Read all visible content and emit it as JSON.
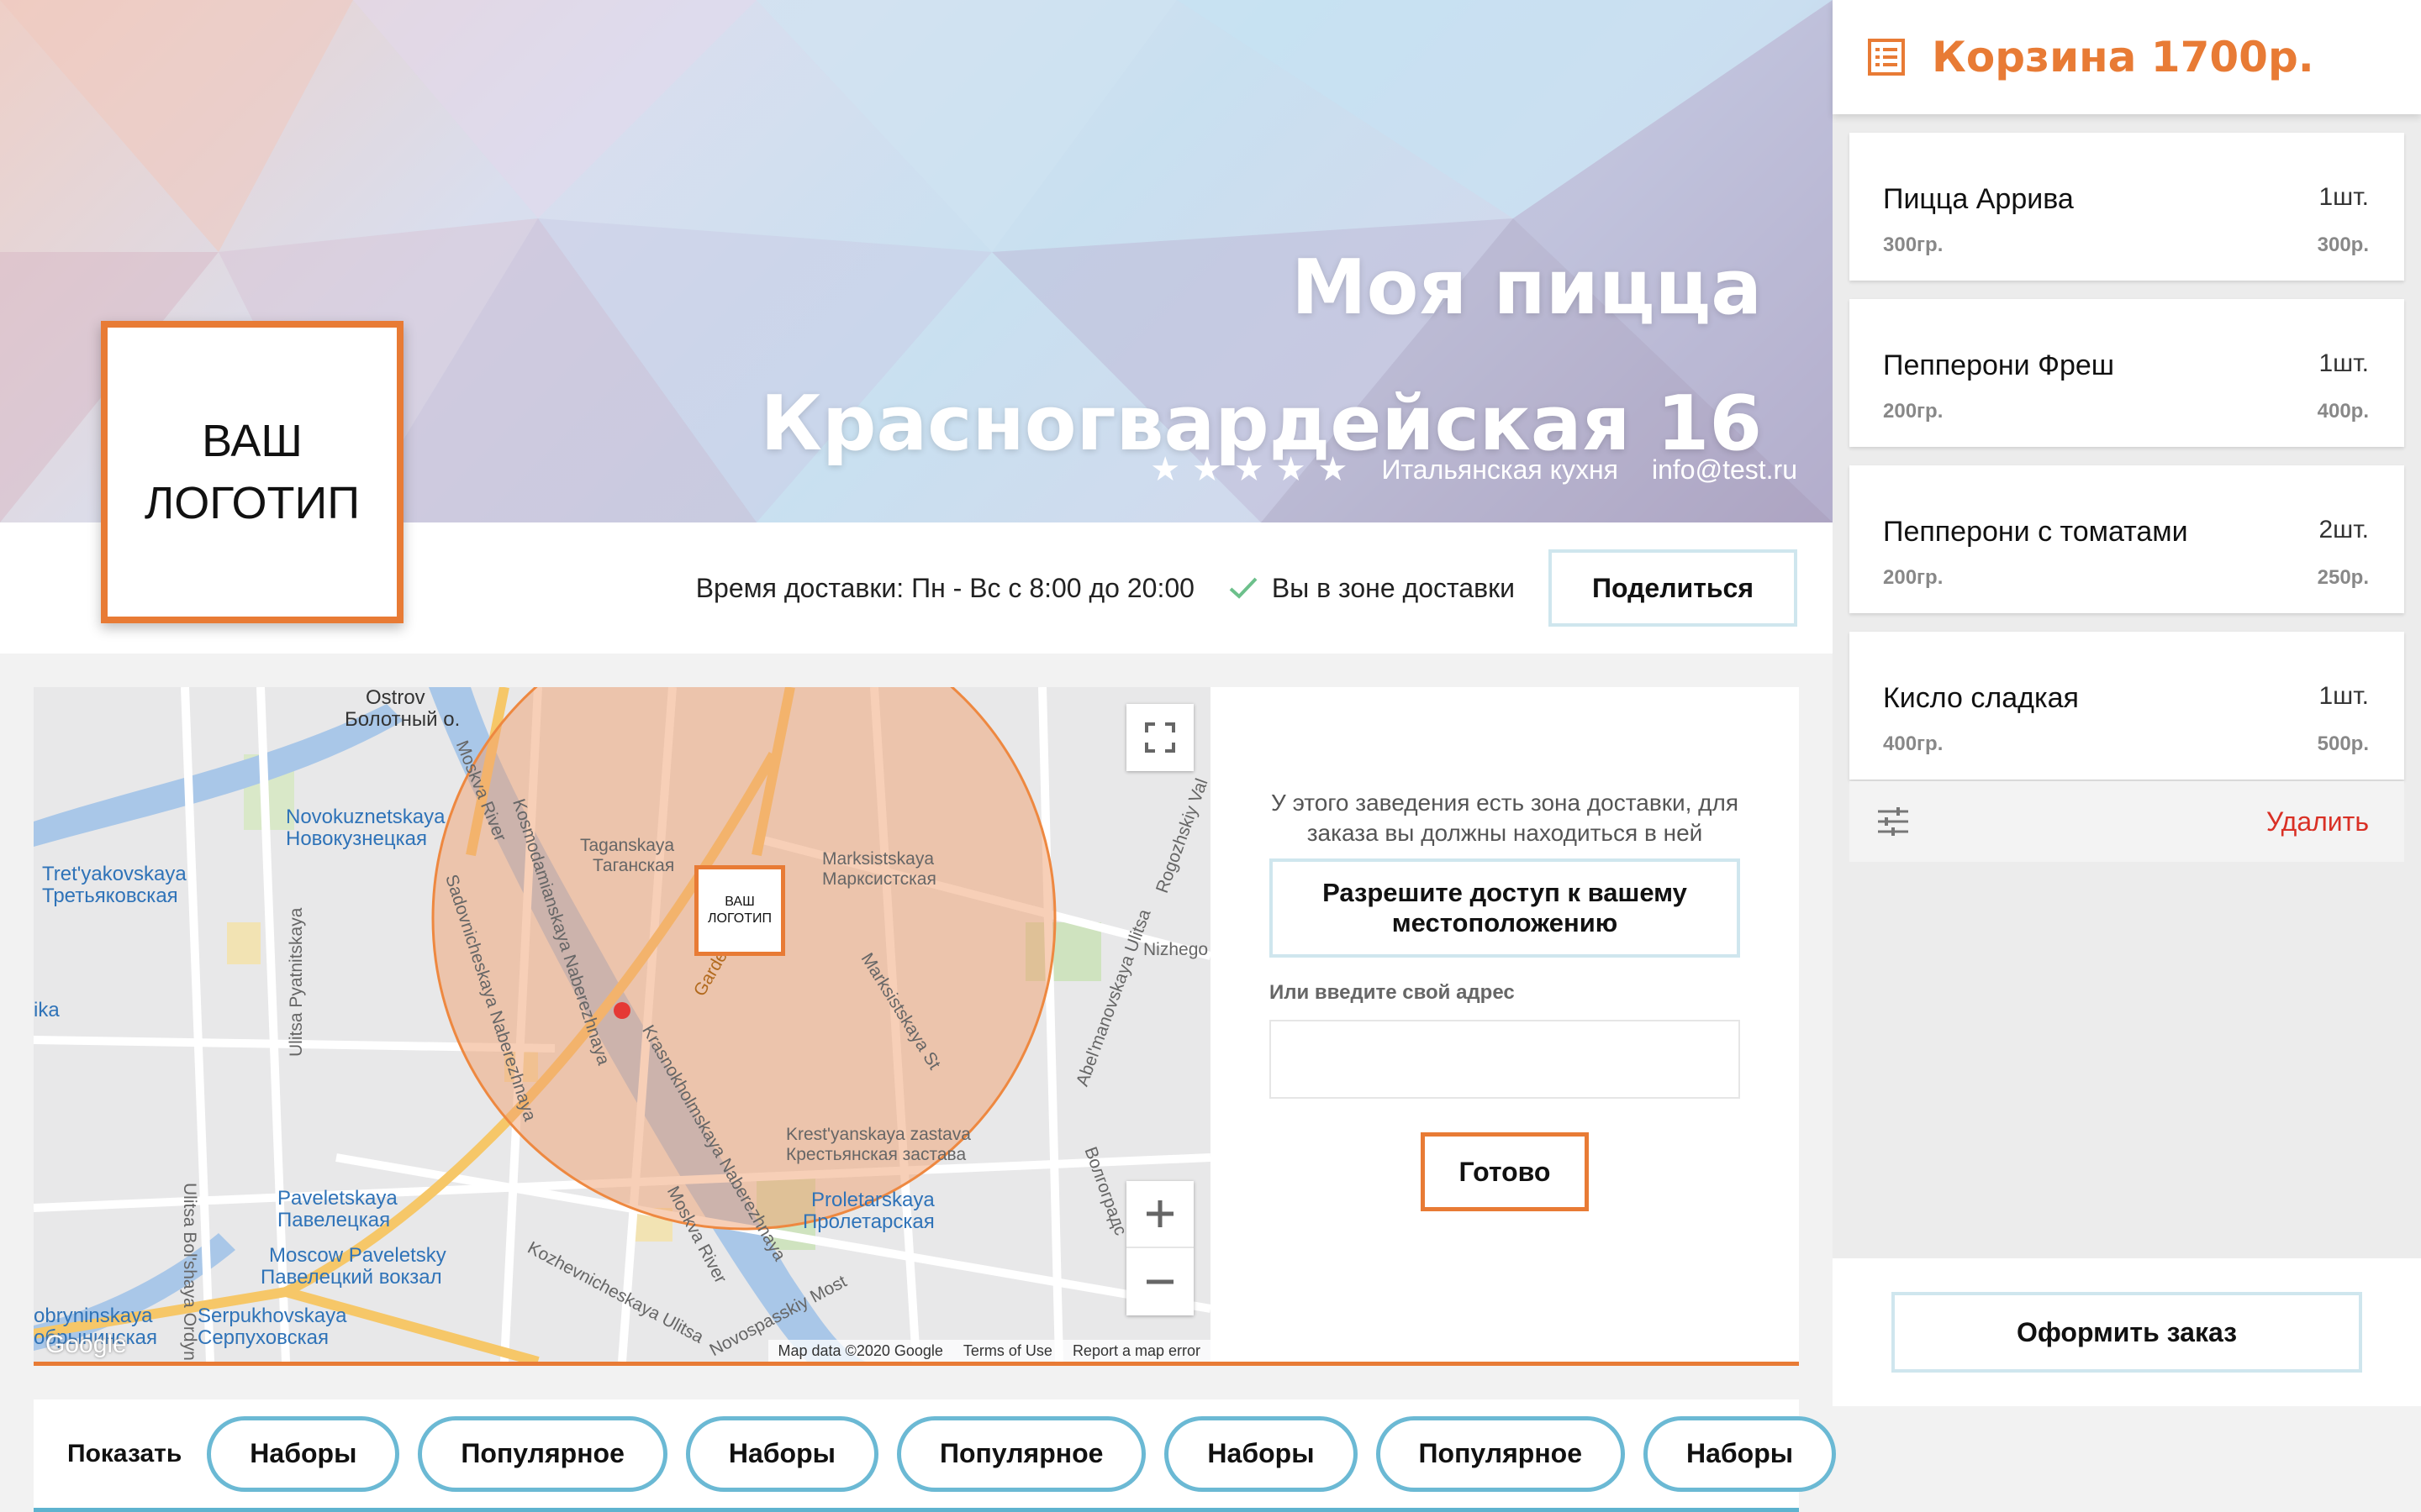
{
  "restaurant": {
    "name_line1": "Моя пицца",
    "name_line2": "Красногвардейская 16",
    "rating_stars": 5,
    "cuisine": "Итальянская кухня",
    "email": "info@test.ru",
    "logo_text_line1": "ВАШ",
    "logo_text_line2": "ЛОГОТИП"
  },
  "info_bar": {
    "delivery_time": "Время доставки: Пн - Вс с 8:00 до 20:00",
    "zone_status": "Вы в зоне доставки",
    "share_label": "Поделиться"
  },
  "map": {
    "labels": {
      "ostrov": "Ostrov",
      "ostrov_ru": "Болотный о.",
      "novokuznetskaya": "Novokuznetskaya",
      "novokuznetskaya_ru": "Новокузнецкая",
      "tretyakovskaya": "Tret'yakovskaya",
      "tretyakovskaya_ru": "Третьяковская",
      "taganskaya": "Taganskaya",
      "taganskaya_ru": "Таганская",
      "marksistskaya": "Marksistskaya",
      "marksistskaya_ru": "Марксистская",
      "paveletskaya": "Paveletskaya",
      "paveletskaya_ru": "Павелецкая",
      "moscow_paveletsky": "Moscow Paveletsky",
      "paveletsky_ru": "Павелецкий вокзал",
      "krestyanskaya": "Krest'yanskaya zastava",
      "krestyanskaya_ru": "Крестьянская застава",
      "proletarskaya": "Proletarskaya",
      "proletarskaya_ru": "Пролетарская",
      "serpukhovskaya": "Serpukhovskaya",
      "serpukhovskaya_ru": "Серпуховская",
      "dobryninskaya": "obryninskaya",
      "dobryninskaya_ru": "обрынинская",
      "nizhego": "Nizhego",
      "ika": "ika",
      "moskva_river": "Moskva River",
      "moskva_river2": "Moskva River",
      "garden": "Garden",
      "kosmodamianskaya": "Kosmodamianskaya Naberezhnaya",
      "sadovnicheskaya": "Sadovnicheskaya Naberezhnaya",
      "krasnokholmskaya": "Krasnokholmskaya Naberezhnaya",
      "marksistskaya_st": "Marksistskaya St",
      "pyatnitskaya": "Ulitsa Pyatnitskaya",
      "ordynka": "Ulitsa Bol'shaya Ordynka",
      "kozhevnicheskaya": "Kozhevnicheskaya Ulitsa",
      "novospassky": "Novospasskiy Most",
      "abelmanovskaya": "Abel'manovskaya Ulitsa",
      "volgogradsky": "Волгоградс",
      "rogozhsky": "Rogozhskiy Val",
      "logo_line1": "ВАШ",
      "logo_line2": "ЛОГОТИП"
    },
    "footer": {
      "data": "Map data ©2020 Google",
      "terms": "Terms of Use",
      "report": "Report a map error"
    },
    "google": "Google"
  },
  "location_panel": {
    "notice": "У этого заведения есть зона доставки, для заказа вы должны находиться в ней",
    "geo_button": "Разрешите доступ к вашему местоположению",
    "address_label": "Или введите свой адрес",
    "address_value": "",
    "address_placeholder": "",
    "ready_button": "Готово"
  },
  "filters": {
    "label": "Показать",
    "pills": [
      "Наборы",
      "Популярное",
      "Наборы",
      "Популярное",
      "Наборы",
      "Популярное",
      "Наборы"
    ]
  },
  "cart": {
    "title": "Корзина 1700р.",
    "items": [
      {
        "name": "Пицца Аррива",
        "qty": "1шт.",
        "weight": "300гр.",
        "price": "300р."
      },
      {
        "name": "Пепперони Фреш",
        "qty": "1шт.",
        "weight": "200гр.",
        "price": "400р."
      },
      {
        "name": "Пепперони с томатами",
        "qty": "2шт.",
        "weight": "200гр.",
        "price": "250р."
      },
      {
        "name": "Кисло сладкая",
        "qty": "1шт.",
        "weight": "400гр.",
        "price": "500р."
      }
    ],
    "delete_label": "Удалить",
    "checkout_label": "Оформить заказ"
  },
  "colors": {
    "accent": "#e87b35",
    "light_blue_border": "#cfe6ee",
    "pill_border": "#6bb9d4",
    "delete_red": "#d93025"
  }
}
